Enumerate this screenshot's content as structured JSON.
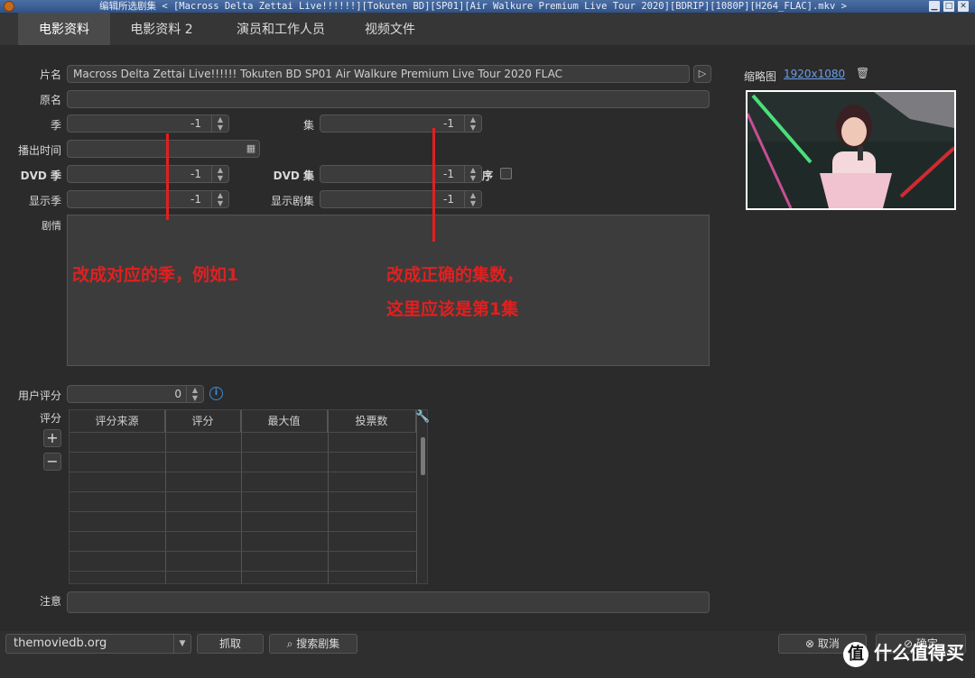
{
  "window": {
    "title": "编辑所选剧集  < [Macross Delta Zettai Live!!!!!!][Tokuten BD][SP01][Air Walkure Premium Live Tour 2020][BDRIP][1080P][H264_FLAC].mkv >",
    "minimize": "▁",
    "maximize": "□",
    "close": "✕"
  },
  "tabs": [
    "电影资料",
    "电影资料 2",
    "演员和工作人员",
    "视频文件"
  ],
  "form": {
    "title_label": "片名",
    "title_value": "Macross Delta Zettai Live!!!!!! Tokuten BD SP01 Air Walkure Premium Live Tour 2020 FLAC",
    "original_label": "原名",
    "original_value": "",
    "season_label": "季",
    "season_value": "-1",
    "episode_label": "集",
    "episode_value": "-1",
    "aired_label": "播出时间",
    "aired_value": "",
    "dvd_season_label": "DVD 季",
    "dvd_season_value": "-1",
    "dvd_episode_label": "DVD 集",
    "dvd_episode_value": "-1",
    "dvd_order_label": "序",
    "display_season_label": "显示季",
    "display_season_value": "-1",
    "display_episode_label": "显示剧集",
    "display_episode_value": "-1",
    "plot_label": "剧情",
    "user_rating_label": "用户评分",
    "user_rating_value": "0",
    "ratings_label": "评分",
    "note_label": "注意"
  },
  "annotations": {
    "season_note": "改成对应的季，例如1",
    "episode_note_line1": "改成正确的集数，",
    "episode_note_line2": "这里应该是第1集"
  },
  "ratings_table": {
    "columns": [
      "评分来源",
      "评分",
      "最大值",
      "投票数"
    ],
    "rows": [],
    "add": "+",
    "remove": "−"
  },
  "thumbnail": {
    "label": "缩略图",
    "resolution": "1920x1080"
  },
  "bottom": {
    "scraper": "themoviedb.org",
    "fetch": "抓取",
    "search": "搜索剧集",
    "cancel": "取消",
    "ok": "确定"
  },
  "watermark": "什么值得买"
}
